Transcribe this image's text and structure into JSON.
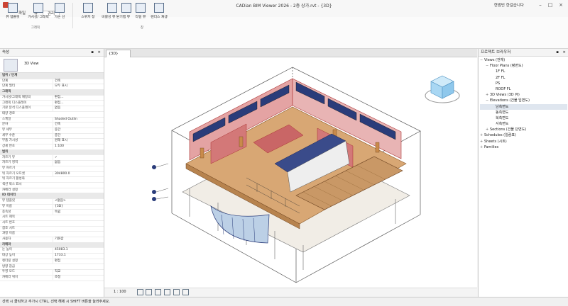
{
  "window": {
    "title": "CADian BIM Viewer 2026 - 2층 상가.rvt - {3D}",
    "user": "현범빈 한걸습니다",
    "controls": [
      "minimize",
      "maximize",
      "close"
    ]
  },
  "menu": {
    "tabs": [
      "파일",
      "뷰",
      "관리"
    ],
    "active_index": 1
  },
  "ribbon": {
    "buttons": [
      {
        "label": "뷰 템플릿",
        "icon": "view-template-icon"
      },
      {
        "label": "가시성/\n그래픽",
        "icon": "visibility-graphics-icon"
      },
      {
        "label": "가는 선",
        "icon": "thin-lines-icon"
      },
      {
        "label": "스위치 창",
        "icon": "switch-window-icon"
      },
      {
        "label": "비활성\n뷰 닫기",
        "icon": "close-inactive-icon"
      },
      {
        "label": "탭 뷰",
        "icon": "tab-views-icon"
      },
      {
        "label": "타일 뷰",
        "icon": "tile-views-icon"
      },
      {
        "label": "렌더스\n재생",
        "icon": "render-icon"
      }
    ],
    "group_labels": [
      "그래픽",
      "창"
    ]
  },
  "properties": {
    "header": "속성",
    "type_name": "3D View",
    "rows": [
      {
        "k": "범위 / 단계",
        "v": "",
        "group": true
      },
      {
        "k": "단계",
        "v": "건축"
      },
      {
        "k": "단계 필터",
        "v": "모두 표시"
      },
      {
        "k": "그래픽",
        "v": "",
        "group": true
      },
      {
        "k": "가시성/그래픽 재정의",
        "v": "편집..."
      },
      {
        "k": "그래픽 디스플레이",
        "v": "편집..."
      },
      {
        "k": "기본 분석 디스플레이",
        "v": "없음"
      },
      {
        "k": "태양 경로",
        "v": ""
      },
      {
        "k": "스케일",
        "v": "Shaded Outlin"
      },
      {
        "k": "분야",
        "v": "건축"
      },
      {
        "k": "뷰 세부",
        "v": "중간"
      },
      {
        "k": "세부 수준",
        "v": "중간"
      },
      {
        "k": "부품 가시성",
        "v": "원래 표시"
      },
      {
        "k": "상세 번호",
        "v": "1:100"
      },
      {
        "k": "범위",
        "v": "",
        "group": true
      },
      {
        "k": "자르기 뷰",
        "v": "✓"
      },
      {
        "k": "자르기 영역",
        "v": "없음"
      },
      {
        "k": "뷰 자르기",
        "v": ""
      },
      {
        "k": "뒤 자르기 오프셋",
        "v": "304800.0"
      },
      {
        "k": "뒤 자르기 활성화",
        "v": ""
      },
      {
        "k": "섹션 박스 표시",
        "v": ""
      },
      {
        "k": "카메라 설정",
        "v": ""
      },
      {
        "k": "ID 데이터",
        "v": "",
        "group": true
      },
      {
        "k": "뷰 템플릿",
        "v": "<없음>"
      },
      {
        "k": "뷰 이름",
        "v": "{3D}"
      },
      {
        "k": "종속성",
        "v": "독립"
      },
      {
        "k": "시트 제목",
        "v": ""
      },
      {
        "k": "시트 번호",
        "v": ""
      },
      {
        "k": "참조 시트",
        "v": ""
      },
      {
        "k": "과정 이름",
        "v": ""
      },
      {
        "k": "사용자",
        "v": "기본값"
      },
      {
        "k": "카메라",
        "v": "",
        "group": true
      },
      {
        "k": "눈 높이",
        "v": "45083.1"
      },
      {
        "k": "대상 높이",
        "v": "1733.1"
      },
      {
        "k": "렌더링 설정",
        "v": "편집"
      },
      {
        "k": "방향 잠금",
        "v": ""
      },
      {
        "k": "투영 모드",
        "v": "직교"
      },
      {
        "k": "카메라 위치",
        "v": "조정"
      }
    ]
  },
  "viewport": {
    "tab_label": "{3D}",
    "scale": "1 : 100",
    "viewcube_label": "Front"
  },
  "browser": {
    "header": "프로젝트 브라우저",
    "tree": [
      {
        "label": "Views (전체)",
        "level": 0,
        "tw": "−"
      },
      {
        "label": "Floor Plans (평면도)",
        "level": 1,
        "tw": "−"
      },
      {
        "label": "1F FL",
        "level": 2,
        "tw": ""
      },
      {
        "label": "2F FL",
        "level": 2,
        "tw": ""
      },
      {
        "label": "PS",
        "level": 2,
        "tw": ""
      },
      {
        "label": "ROOF FL",
        "level": 2,
        "tw": ""
      },
      {
        "label": "3D Views (3D 뷰)",
        "level": 1,
        "tw": "+"
      },
      {
        "label": "Elevations (건물 입면도)",
        "level": 1,
        "tw": "−"
      },
      {
        "label": "남측면도",
        "level": 2,
        "tw": "",
        "sel": true
      },
      {
        "label": "동측면도",
        "level": 2,
        "tw": ""
      },
      {
        "label": "북측면도",
        "level": 2,
        "tw": ""
      },
      {
        "label": "서측면도",
        "level": 2,
        "tw": ""
      },
      {
        "label": "Sections (건물 단면도)",
        "level": 1,
        "tw": "+"
      },
      {
        "label": "Schedules (일람표)",
        "level": 0,
        "tw": "+"
      },
      {
        "label": "Sheets (시트)",
        "level": 0,
        "tw": "+"
      },
      {
        "label": "Families",
        "level": 0,
        "tw": "+"
      }
    ]
  },
  "status": {
    "hint": "선택 시 클릭하고 추가시 CTRL, 선택 해제 시 SHIFT 버튼을 눌러주세요."
  },
  "colors": {
    "accent": "#c43c3c",
    "wall_red": "#d87a7a",
    "floor_wood": "#d8a774",
    "glass": "#2a3c7a"
  }
}
